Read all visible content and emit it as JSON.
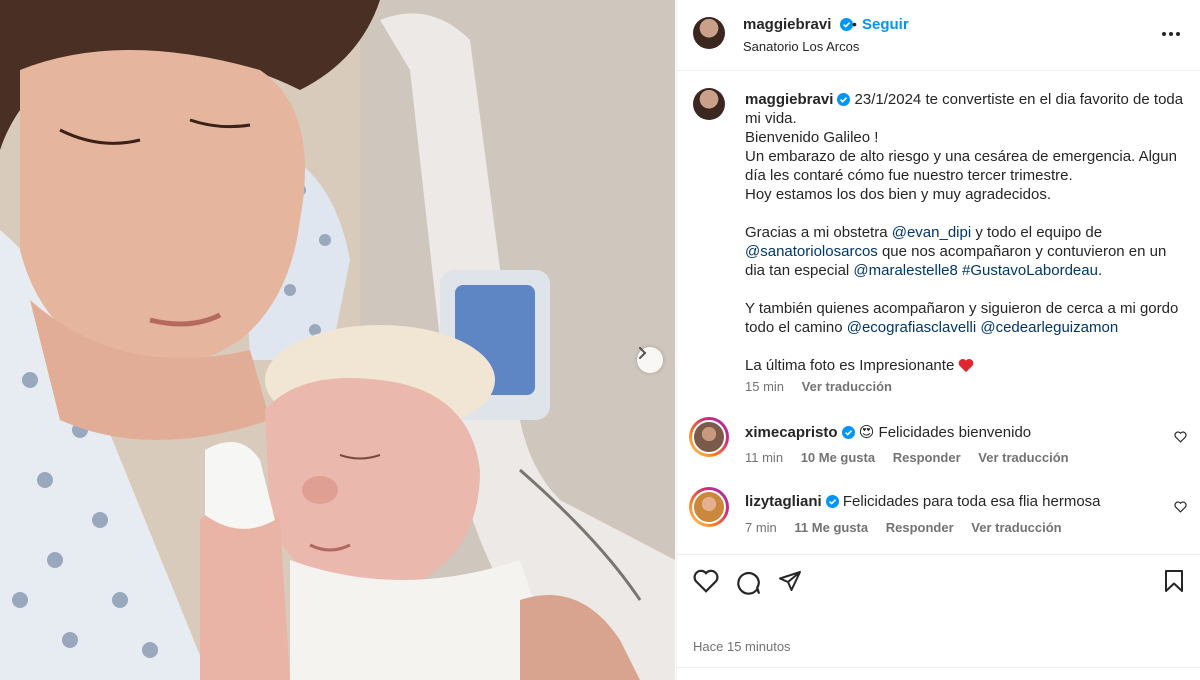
{
  "post": {
    "username": "maggiebravi",
    "follow_label": "Seguir",
    "separator": "•",
    "location": "Sanatorio Los Arcos"
  },
  "caption": {
    "username": "maggiebravi",
    "line1": "23/1/2024 te convertiste en el dia favorito de toda mi vida.",
    "line2": "Bienvenido Galileo !",
    "line3": "Un embarazo de alto riesgo y una cesárea de emergencia. Algun día les contaré cómo fue nuestro tercer trimestre.",
    "line4": "Hoy estamos los dos bien y muy agradecidos.",
    "p2_a": "Gracias a mi obstetra ",
    "mention1": "@evan_dipi",
    "p2_b": " y todo el equipo de ",
    "mention2": "@sanatoriolosarcos",
    "p2_c": " que nos acompañaron y contuvieron en un dia tan especial ",
    "mention3": "@maralestelle8",
    "hashtag1": "#GustavoLabordeau",
    "p2_end": ".",
    "p3_a": "Y también quienes acompañaron y siguieron de cerca a mi gordo todo el camino ",
    "mention4": "@ecografiasclavelli",
    "mention5": "@cedearleguizamon",
    "p4": "La última foto es Impresionante ",
    "time": "15 min",
    "translate": "Ver traducción"
  },
  "comments": [
    {
      "username": "ximecapristo",
      "text": "Felicidades bienvenido",
      "emoji": "😍",
      "time": "11 min",
      "likes": "10 Me gusta",
      "reply": "Responder",
      "translate": "Ver traducción"
    },
    {
      "username": "lizytagliani",
      "text": "Felicidades para toda esa flia hermosa",
      "time": "7 min",
      "likes": "11 Me gusta",
      "reply": "Responder",
      "translate": "Ver traducción"
    }
  ],
  "footer": {
    "time_ago": "Hace 15 minutos"
  },
  "colors": {
    "accent": "#0095f6",
    "link": "#00376b",
    "muted": "#737373",
    "heart_red": "#ed4956"
  },
  "icons": [
    "next-arrow-icon",
    "verified-icon",
    "more-icon",
    "heart-icon",
    "comment-icon",
    "share-icon",
    "bookmark-icon"
  ]
}
